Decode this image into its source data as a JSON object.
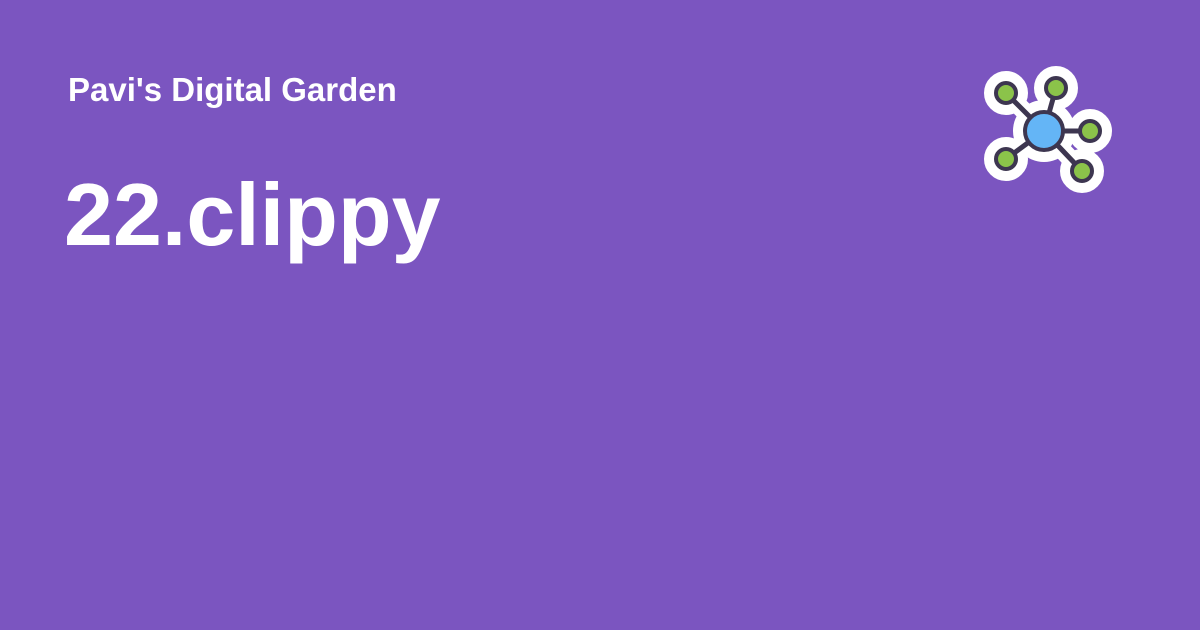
{
  "header": {
    "site_name": "Pavi's Digital Garden",
    "page_title": "22.clippy"
  },
  "logo": {
    "icon": "network-graph-icon",
    "center_color": "#64b5f6",
    "node_color": "#8bc34a",
    "outline_color": "#3d3650",
    "halo_color": "#ffffff"
  },
  "colors": {
    "background": "#7b55c0",
    "text": "#ffffff"
  }
}
